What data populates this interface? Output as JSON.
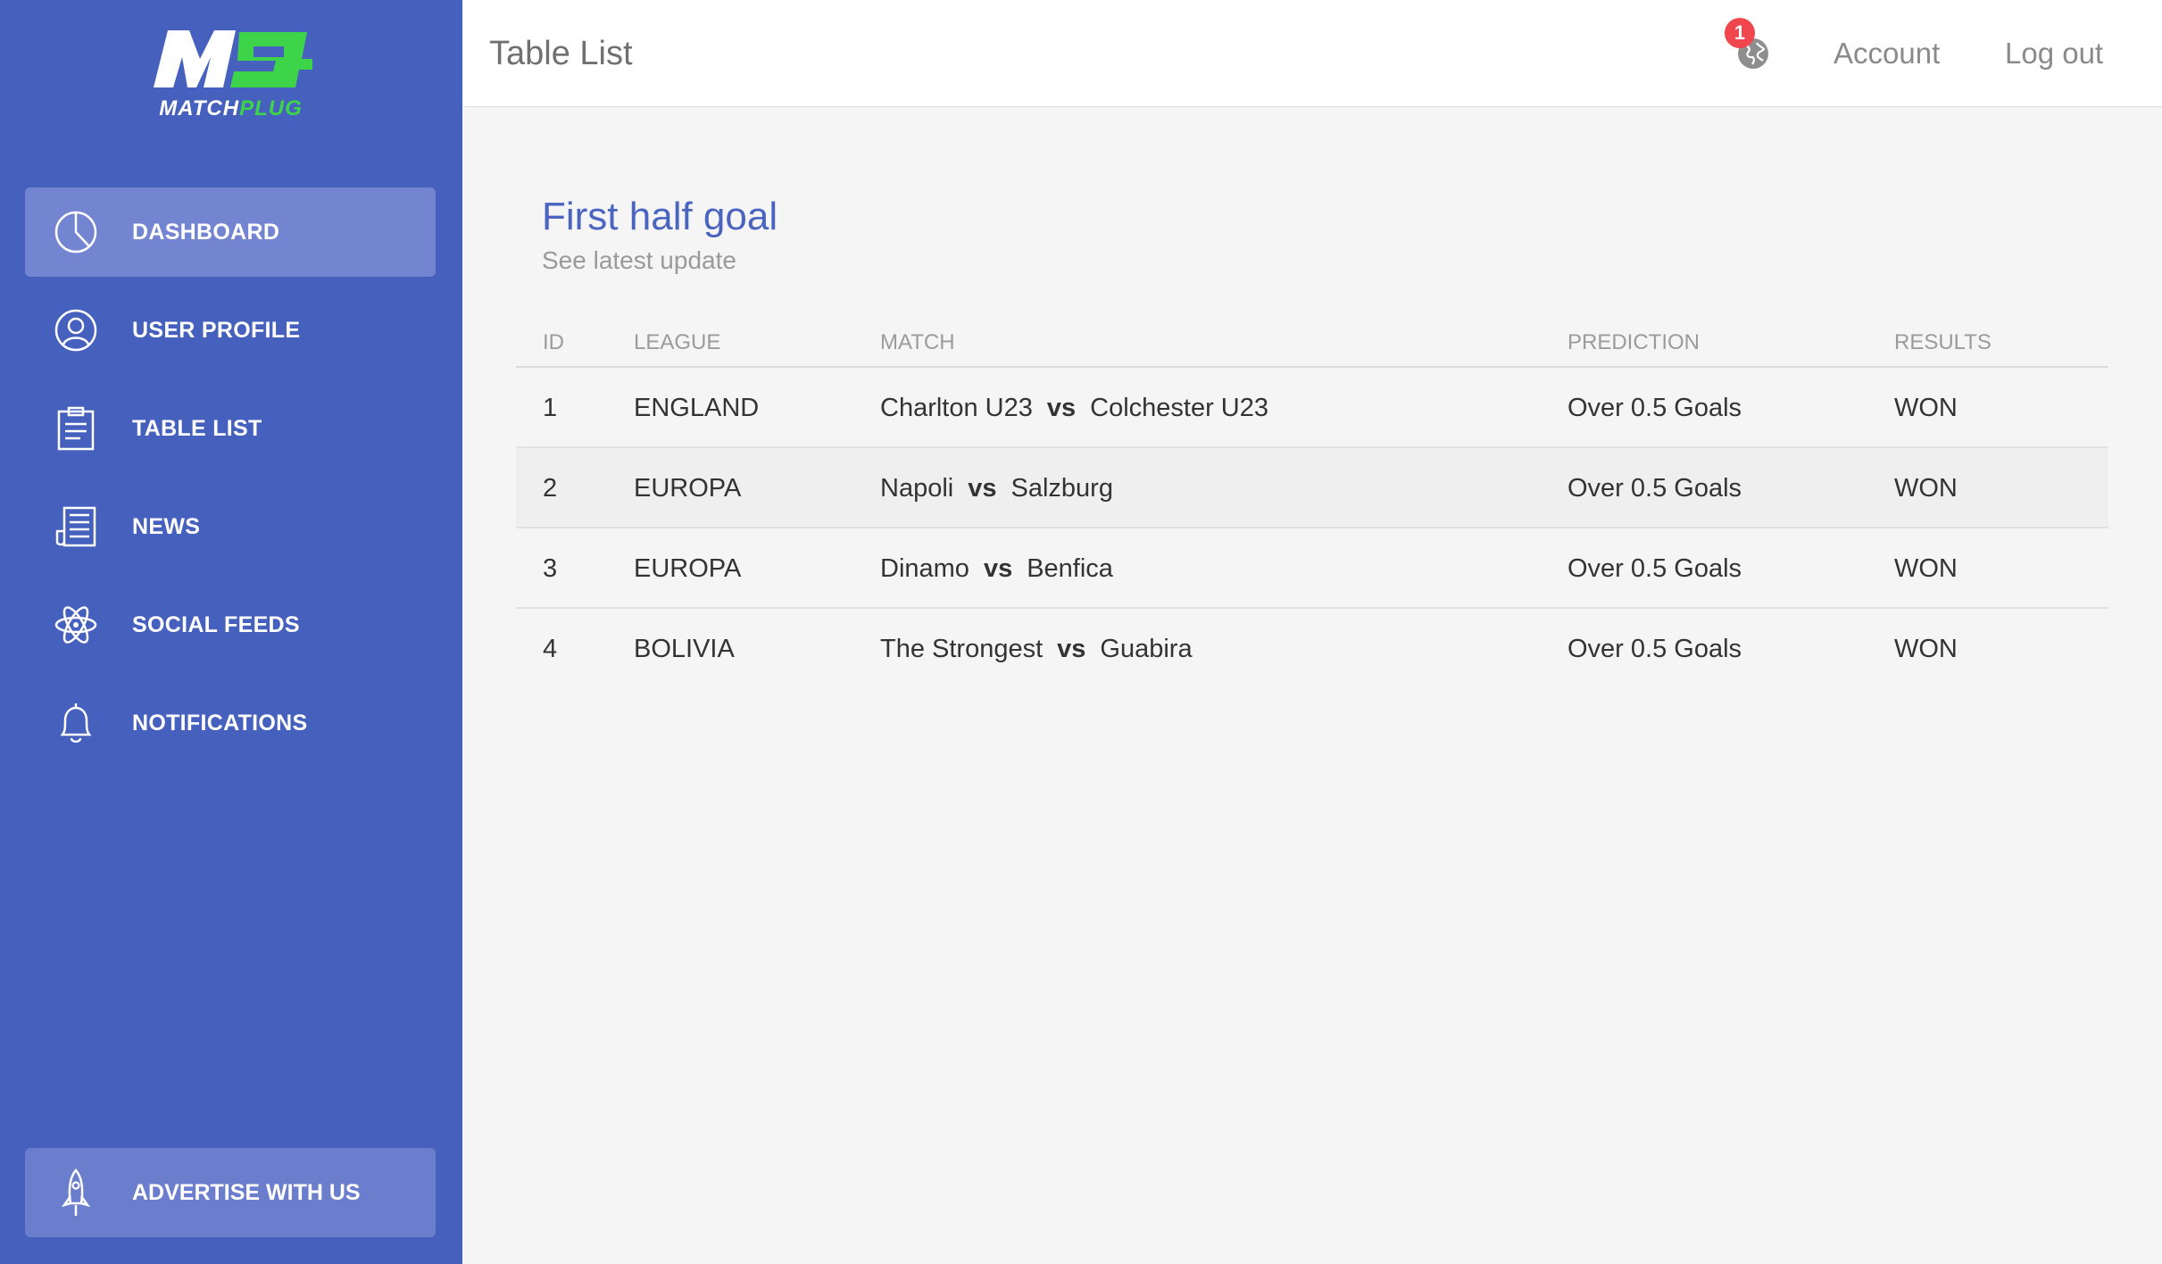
{
  "brand": {
    "word_main": "MATCH",
    "word_accent": "PLUG",
    "mark_text": "M",
    "accent_color": "#3ed44a"
  },
  "sidebar": {
    "items": [
      {
        "label": "DASHBOARD",
        "icon": "pie-chart-icon",
        "active": true
      },
      {
        "label": "USER PROFILE",
        "icon": "user-icon"
      },
      {
        "label": "TABLE LIST",
        "icon": "clipboard-icon"
      },
      {
        "label": "NEWS",
        "icon": "newspaper-icon"
      },
      {
        "label": "SOCIAL FEEDS",
        "icon": "atom-icon"
      },
      {
        "label": "NOTIFICATIONS",
        "icon": "bell-icon"
      }
    ],
    "advertise": {
      "label": "ADVERTISE WITH US",
      "icon": "rocket-icon"
    }
  },
  "header": {
    "title": "Table List",
    "notification_count": "1",
    "account_label": "Account",
    "logout_label": "Log out"
  },
  "card": {
    "title": "First half goal",
    "subtitle": "See latest update"
  },
  "table": {
    "columns": [
      "ID",
      "LEAGUE",
      "MATCH",
      "PREDICTION",
      "RESULTS"
    ],
    "vs_label": "vs",
    "rows": [
      {
        "id": "1",
        "league": "ENGLAND",
        "home": "Charlton U23",
        "away": "Colchester U23",
        "prediction": "Over 0.5 Goals",
        "result": "WON"
      },
      {
        "id": "2",
        "league": "EUROPA",
        "home": "Napoli",
        "away": "Salzburg",
        "prediction": "Over 0.5 Goals",
        "result": "WON"
      },
      {
        "id": "3",
        "league": "EUROPA",
        "home": "Dinamo",
        "away": "Benfica",
        "prediction": "Over 0.5 Goals",
        "result": "WON"
      },
      {
        "id": "4",
        "league": "BOLIVIA",
        "home": "The Strongest",
        "away": "Guabira",
        "prediction": "Over 0.5 Goals",
        "result": "WON"
      }
    ]
  },
  "colors": {
    "sidebar": "#4660be",
    "active_item": "#7385d0",
    "title_blue": "#4a64c0",
    "badge": "#f0464e"
  }
}
